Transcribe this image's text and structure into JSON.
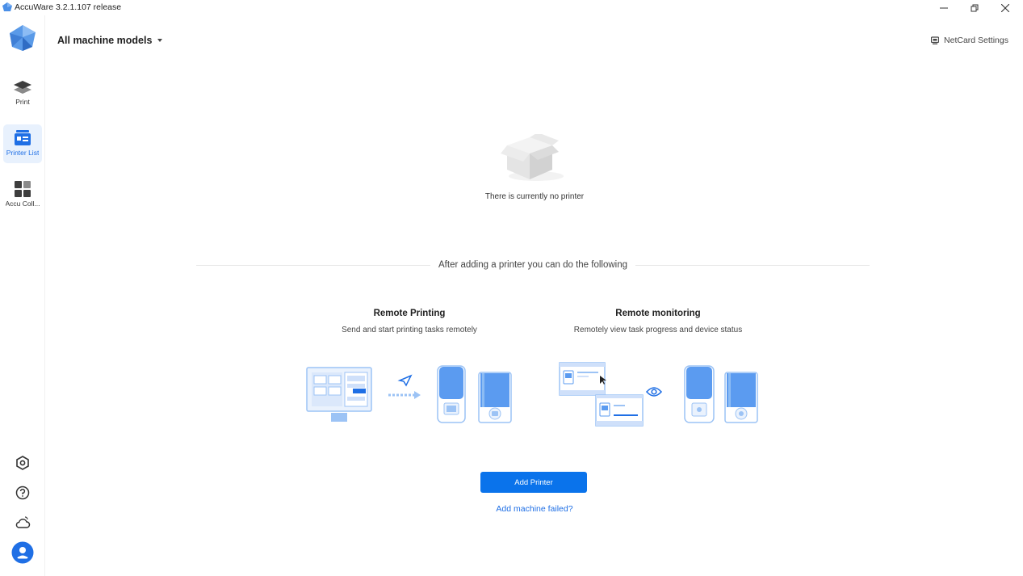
{
  "window": {
    "title": "AccuWare 3.2.1.107 release"
  },
  "sidebar": {
    "items": [
      {
        "label": "Print",
        "icon": "layers-icon"
      },
      {
        "label": "Printer List",
        "icon": "printer-list-icon",
        "active": true
      },
      {
        "label": "Accu Coll...",
        "icon": "collection-icon"
      }
    ],
    "bottom_icons": [
      "settings-icon",
      "help-icon",
      "cloud-icon",
      "user-avatar-icon"
    ]
  },
  "header": {
    "model_filter": "All machine models",
    "netcard_settings": "NetCard Settings"
  },
  "empty_state": {
    "message": "There is currently no printer"
  },
  "features": {
    "heading": "After adding a printer you can do the following",
    "remote_printing": {
      "title": "Remote Printing",
      "description": "Send and start printing tasks remotely"
    },
    "remote_monitoring": {
      "title": "Remote monitoring",
      "description": "Remotely view task progress and device status"
    }
  },
  "actions": {
    "add_printer": "Add Printer",
    "add_failed": "Add machine failed?"
  },
  "colors": {
    "accent": "#0a73eb",
    "accent_light": "#e8f1fd",
    "illustration_blue": "#5b9bf0"
  }
}
